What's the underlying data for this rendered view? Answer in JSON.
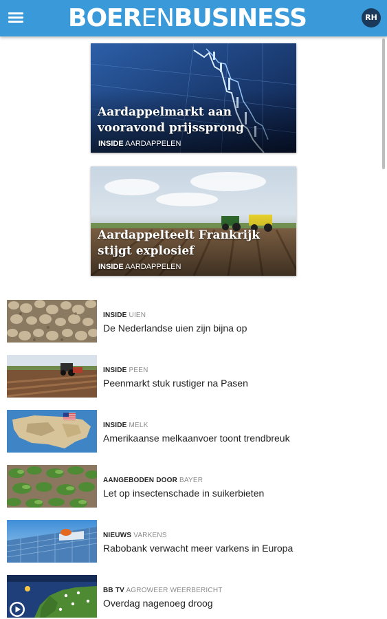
{
  "header": {
    "logo_part1": "BOER",
    "logo_part2": "EN",
    "logo_part3": "BUSINESS",
    "avatar_initials": "RH",
    "menu_icon": "hamburger-menu-icon",
    "bar_color": "#3a9ad9"
  },
  "featured": [
    {
      "title": "Aardappelmarkt aan vooravond prijssprong",
      "kind": "INSIDE",
      "category": "AARDAPPELEN"
    },
    {
      "title": "Aardappelteelt Frankrijk stijgt explosief",
      "kind": "INSIDE",
      "category": "AARDAPPELEN"
    }
  ],
  "articles": [
    {
      "kind": "INSIDE",
      "category": "UIEN",
      "headline": "De Nederlandse uien zijn bijna op"
    },
    {
      "kind": "INSIDE",
      "category": "PEEN",
      "headline": "Peenmarkt stuk rustiger na Pasen"
    },
    {
      "kind": "INSIDE",
      "category": "MELK",
      "headline": "Amerikaanse melkaanvoer toont trendbreuk"
    },
    {
      "kind": "AANGEBODEN DOOR",
      "category": "BAYER",
      "headline": "Let op insectenschade in suikerbieten"
    },
    {
      "kind": "NIEUWS",
      "category": "VARKENS",
      "headline": "Rabobank verwacht meer varkens in Europa"
    },
    {
      "kind": "BB TV",
      "category": "AGROWEER WEERBERICHT",
      "headline": "Overdag nagenoeg droog"
    }
  ],
  "play_icon": "play-icon"
}
